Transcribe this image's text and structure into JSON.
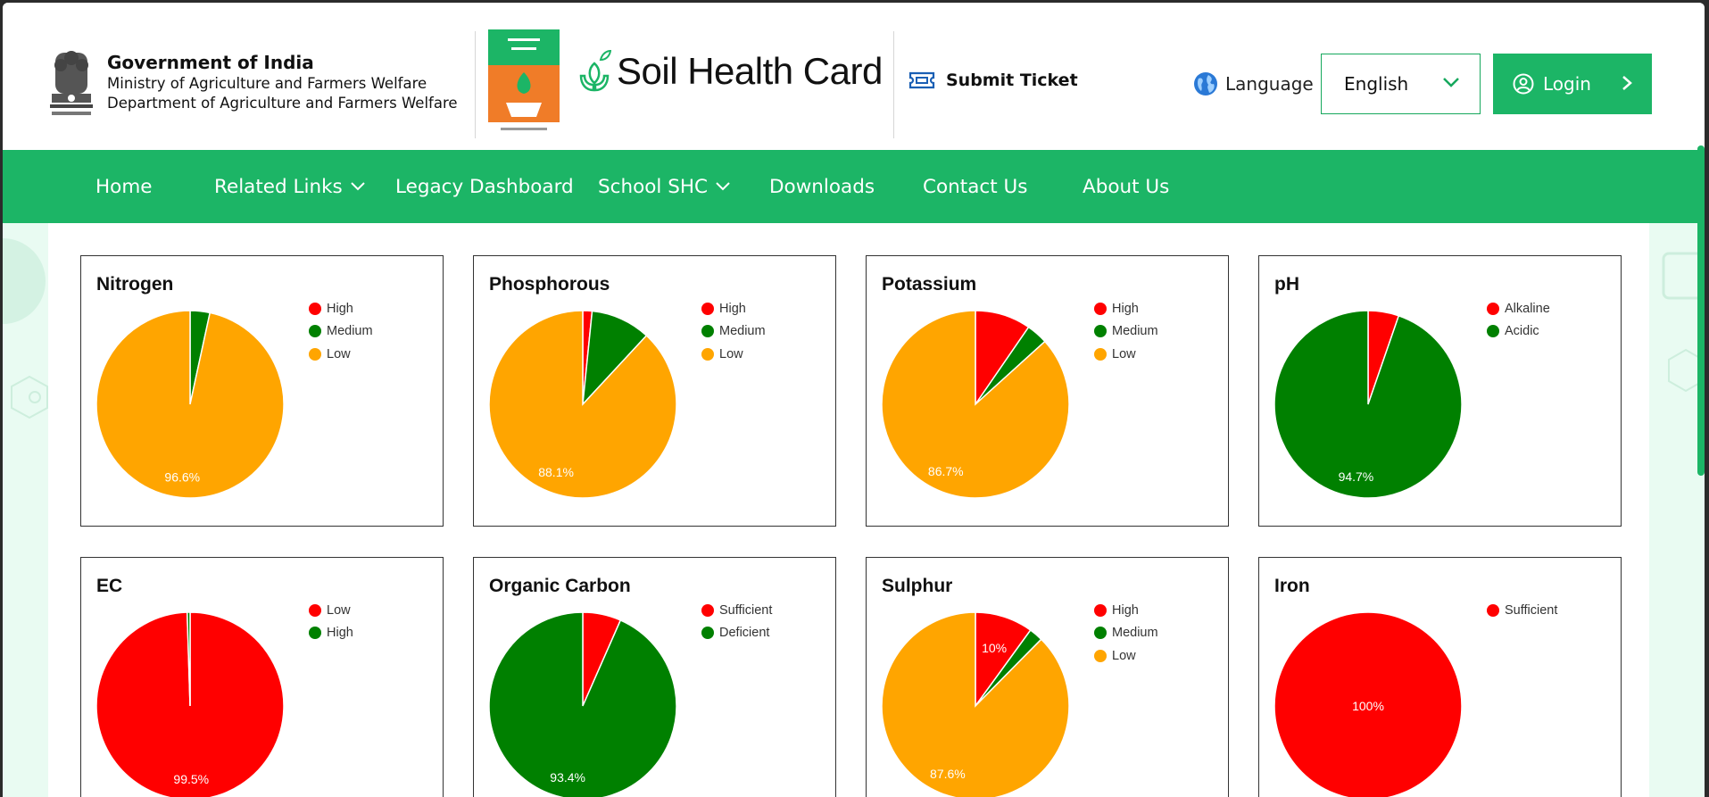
{
  "header": {
    "gov_title": "Government of India",
    "ministry": "Ministry of Agriculture and Farmers Welfare",
    "department": "Department of Agriculture and Farmers Welfare",
    "brand": "Soil Health Card",
    "submit_ticket": "Submit Ticket",
    "language_label": "Language",
    "language_value": "English",
    "login": "Login"
  },
  "nav": [
    {
      "label": "Home",
      "dropdown": false
    },
    {
      "label": "Related Links",
      "dropdown": true
    },
    {
      "label": "Legacy Dashboard",
      "dropdown": false
    },
    {
      "label": "School SHC",
      "dropdown": true
    },
    {
      "label": "Downloads",
      "dropdown": false
    },
    {
      "label": "Contact Us",
      "dropdown": false
    },
    {
      "label": "About Us",
      "dropdown": false
    }
  ],
  "colors": {
    "brand_green": "#1cb566",
    "red": "#ff0000",
    "green": "#008000",
    "orange": "#ffa500"
  },
  "chart_data": [
    {
      "type": "pie",
      "title": "Nitrogen",
      "series": [
        {
          "name": "High",
          "value": 0.0,
          "color": "#ff0000"
        },
        {
          "name": "Medium",
          "value": 3.4,
          "color": "#008000"
        },
        {
          "name": "Low",
          "value": 96.6,
          "color": "#ffa500"
        }
      ],
      "data_labels": [
        {
          "series": "Low",
          "text": "96.6%"
        }
      ]
    },
    {
      "type": "pie",
      "title": "Phosphorous",
      "series": [
        {
          "name": "High",
          "value": 1.6,
          "color": "#ff0000"
        },
        {
          "name": "Medium",
          "value": 10.3,
          "color": "#008000"
        },
        {
          "name": "Low",
          "value": 88.1,
          "color": "#ffa500"
        }
      ],
      "data_labels": [
        {
          "series": "Low",
          "text": "88.1%"
        }
      ]
    },
    {
      "type": "pie",
      "title": "Potassium",
      "series": [
        {
          "name": "High",
          "value": 9.6,
          "color": "#ff0000"
        },
        {
          "name": "Medium",
          "value": 3.7,
          "color": "#008000"
        },
        {
          "name": "Low",
          "value": 86.7,
          "color": "#ffa500"
        }
      ],
      "data_labels": [
        {
          "series": "Low",
          "text": "86.7%"
        }
      ]
    },
    {
      "type": "pie",
      "title": "pH",
      "series": [
        {
          "name": "Alkaline",
          "value": 5.3,
          "color": "#ff0000"
        },
        {
          "name": "Acidic",
          "value": 94.7,
          "color": "#008000"
        }
      ],
      "data_labels": [
        {
          "series": "Acidic",
          "text": "94.7%"
        }
      ]
    },
    {
      "type": "pie",
      "title": "EC",
      "series": [
        {
          "name": "Low",
          "value": 99.5,
          "color": "#ff0000"
        },
        {
          "name": "High",
          "value": 0.5,
          "color": "#008000"
        }
      ],
      "data_labels": [
        {
          "series": "Low",
          "text": "99.5%"
        }
      ]
    },
    {
      "type": "pie",
      "title": "Organic Carbon",
      "series": [
        {
          "name": "Sufficient",
          "value": 6.6,
          "color": "#ff0000"
        },
        {
          "name": "Deficient",
          "value": 93.4,
          "color": "#008000"
        }
      ],
      "data_labels": [
        {
          "series": "Deficient",
          "text": "93.4%"
        }
      ]
    },
    {
      "type": "pie",
      "title": "Sulphur",
      "series": [
        {
          "name": "High",
          "value": 10,
          "color": "#ff0000"
        },
        {
          "name": "Medium",
          "value": 2.4,
          "color": "#008000"
        },
        {
          "name": "Low",
          "value": 87.6,
          "color": "#ffa500"
        }
      ],
      "data_labels": [
        {
          "series": "High",
          "text": "10%"
        },
        {
          "series": "Low",
          "text": "87.6%"
        }
      ]
    },
    {
      "type": "pie",
      "title": "Iron",
      "series": [
        {
          "name": "Sufficient",
          "value": 100,
          "color": "#ff0000"
        }
      ],
      "data_labels": [
        {
          "series": "Sufficient",
          "text": "100%"
        }
      ]
    }
  ]
}
